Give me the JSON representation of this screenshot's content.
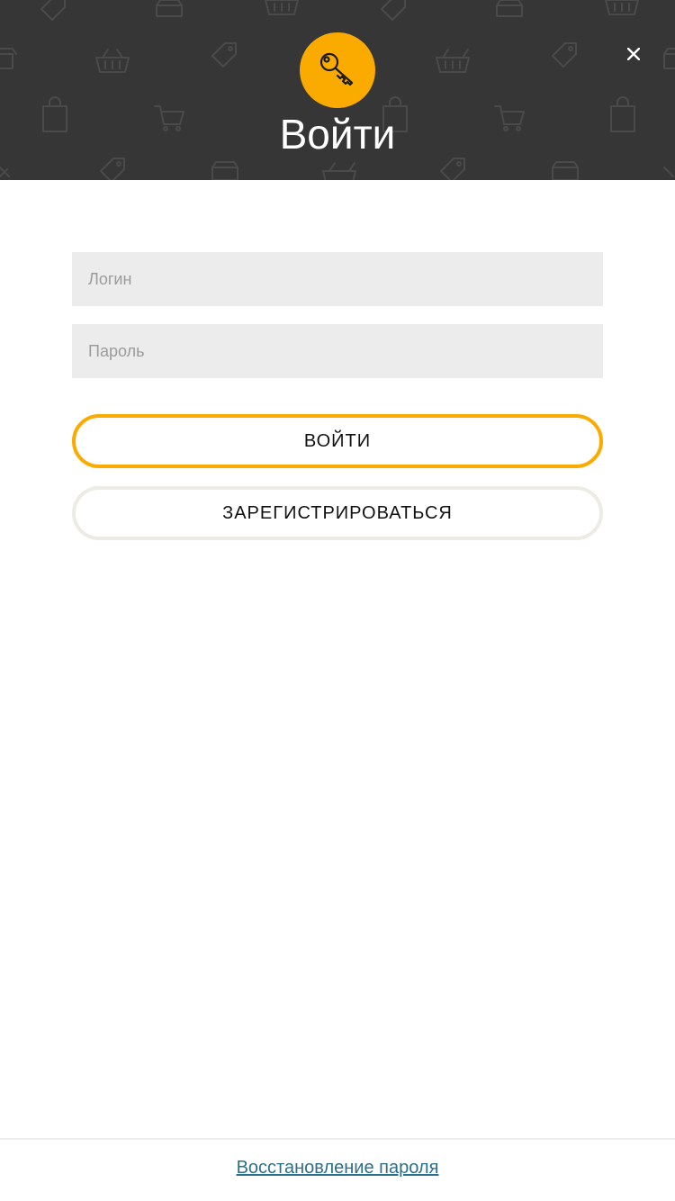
{
  "header": {
    "title": "Войти",
    "icon": "key-icon",
    "close_icon": "close-icon",
    "background_color": "#363636",
    "accent_color": "#fbab00"
  },
  "form": {
    "login_placeholder": "Логин",
    "password_placeholder": "Пароль",
    "login_button_label": "ВОЙТИ",
    "register_button_label": "ЗАРЕГИСТРИРОВАТЬСЯ"
  },
  "footer": {
    "recover_link_label": "Восстановление пароля",
    "link_color": "#2c6f8a"
  }
}
